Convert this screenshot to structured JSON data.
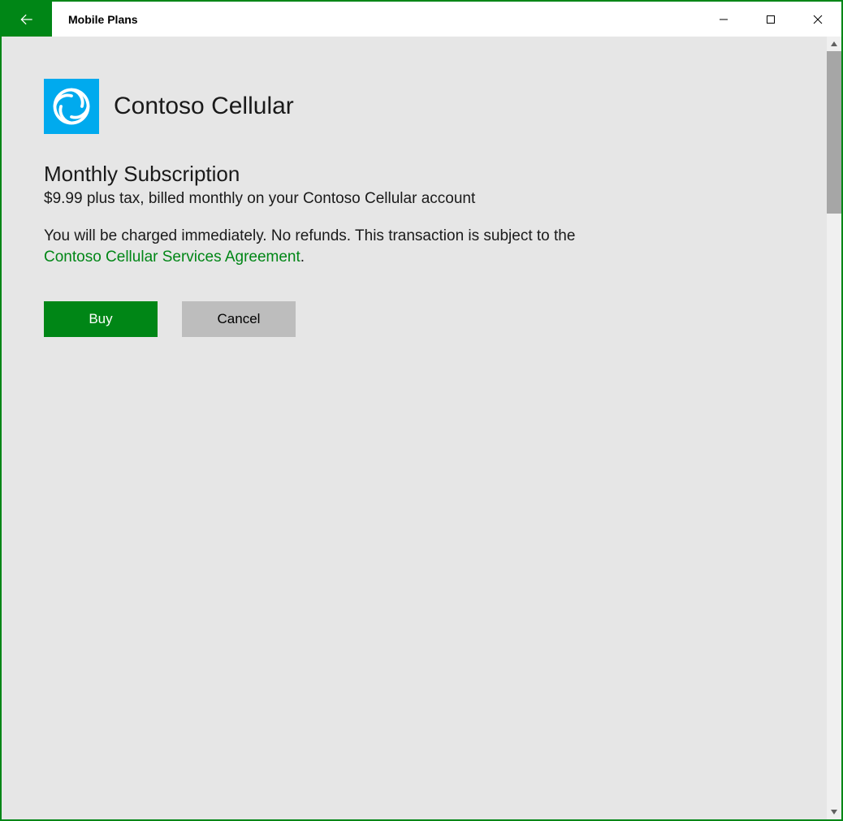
{
  "window": {
    "title": "Mobile Plans"
  },
  "brand": {
    "name": "Contoso Cellular"
  },
  "plan": {
    "title": "Monthly Subscription",
    "price_line": "$9.99 plus tax, billed monthly on your Contoso Cellular account"
  },
  "disclaimer": {
    "text_before": "You will be charged immediately. No refunds. This transaction is subject to the ",
    "link_text": "Contoso Cellular Services Agreement",
    "text_after": "."
  },
  "buttons": {
    "buy": "Buy",
    "cancel": "Cancel"
  }
}
